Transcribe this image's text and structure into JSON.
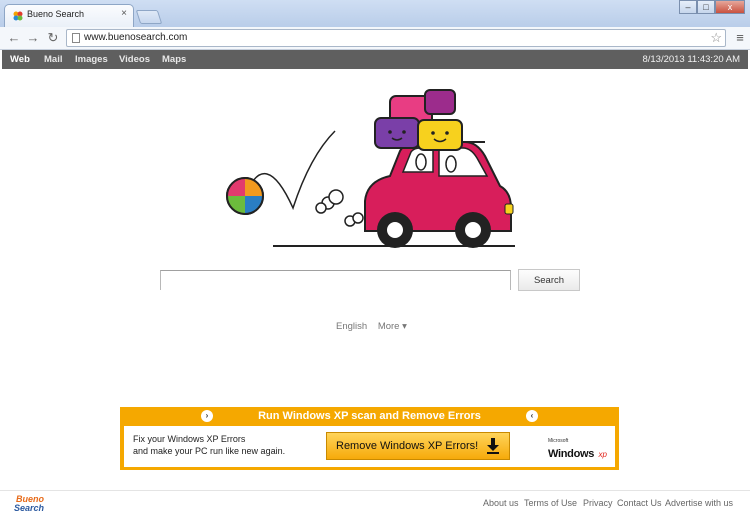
{
  "browser": {
    "tab_title": "Bueno Search",
    "tab_close": "×",
    "url": "www.buenosearch.com",
    "back": "←",
    "forward": "→",
    "reload": "↻",
    "star": "☆",
    "menu": "≡",
    "window_minimize": "–",
    "window_maximize": "□",
    "window_close": "x"
  },
  "nav": {
    "items": [
      {
        "label": "Web",
        "active": true
      },
      {
        "label": "Mail",
        "active": false
      },
      {
        "label": "Images",
        "active": false
      },
      {
        "label": "Videos",
        "active": false
      },
      {
        "label": "Maps",
        "active": false
      }
    ],
    "datetime": "8/13/2013 11:43:20 AM"
  },
  "search": {
    "value": "",
    "button_label": "Search"
  },
  "language": {
    "current": "English",
    "more": "More ▾"
  },
  "ad": {
    "title": "Run Windows XP scan and Remove Errors",
    "left_arrow": "›",
    "right_arrow": "‹",
    "line1": "Fix your Windows XP Errors",
    "line2": "and make your PC run like new again.",
    "cta_label": "Remove Windows XP Errors!",
    "logo_small": "Microsoft",
    "logo_windows": "Windows",
    "logo_xp": "xp"
  },
  "footer": {
    "logo_top": "Bueno",
    "logo_bottom": "Search",
    "links": [
      "About us",
      "Terms of Use",
      "Privacy",
      "Contact Us",
      "Advertise with us"
    ]
  },
  "colors": {
    "navbar": "#5f5f5f",
    "ad_orange": "#f5a800",
    "car_red": "#d81e5b"
  }
}
